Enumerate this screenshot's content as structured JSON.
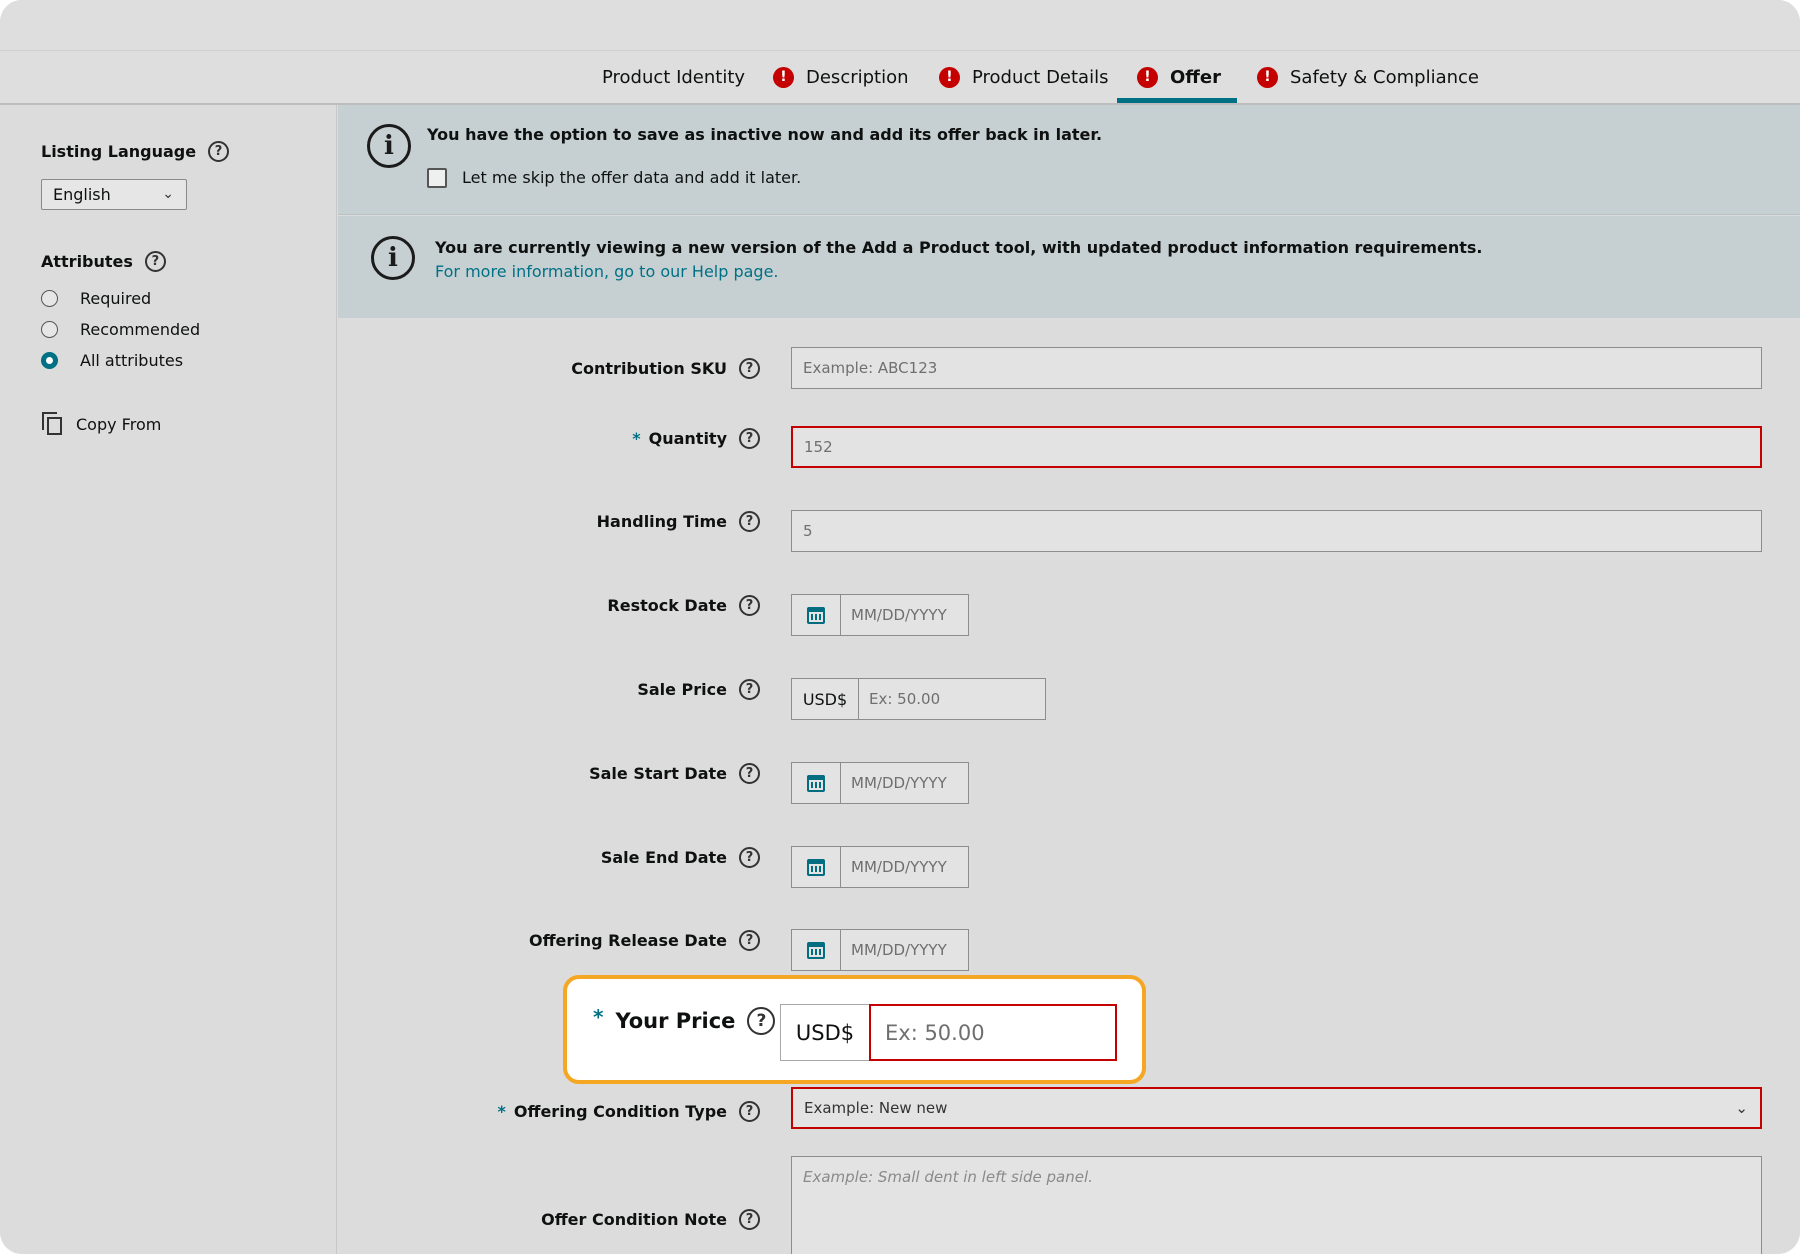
{
  "tabs": [
    {
      "label": "Product Identity",
      "error": false,
      "active": false
    },
    {
      "label": "Description",
      "error": true,
      "active": false
    },
    {
      "label": "Product Details",
      "error": true,
      "active": false
    },
    {
      "label": "Offer",
      "error": true,
      "active": true
    },
    {
      "label": "Safety & Compliance",
      "error": true,
      "active": false
    }
  ],
  "sidebar": {
    "listing_language_label": "Listing Language",
    "language_value": "English",
    "attributes_label": "Attributes",
    "attribute_options": [
      {
        "label": "Required",
        "checked": false
      },
      {
        "label": "Recommended",
        "checked": false
      },
      {
        "label": "All attributes",
        "checked": true
      }
    ],
    "copy_from_label": "Copy From"
  },
  "banners": {
    "skip_title": "You have the option to save as inactive now and add its offer back in later.",
    "skip_checkbox_label": "Let me skip the offer data and add it later.",
    "skip_checked": false,
    "version_title": "You are currently viewing a new version of the Add a Product tool, with updated product information requirements.",
    "version_link": "For more information, go to our Help page."
  },
  "form": {
    "contribution_sku": {
      "label": "Contribution SKU",
      "required": false,
      "placeholder": "Example: ABC123",
      "value": ""
    },
    "quantity": {
      "label": "Quantity",
      "required": true,
      "value": "152"
    },
    "handling_time": {
      "label": "Handling Time",
      "required": false,
      "value": "5"
    },
    "restock_date": {
      "label": "Restock Date",
      "placeholder": "MM/DD/YYYY"
    },
    "sale_price": {
      "label": "Sale Price",
      "currency": "USD$",
      "placeholder": "Ex: 50.00"
    },
    "sale_start_date": {
      "label": "Sale Start Date",
      "placeholder": "MM/DD/YYYY"
    },
    "sale_end_date": {
      "label": "Sale End Date",
      "placeholder": "MM/DD/YYYY"
    },
    "offering_release_date": {
      "label": "Offering Release Date",
      "placeholder": "MM/DD/YYYY"
    },
    "your_price": {
      "label": "Your Price",
      "required": true,
      "currency": "USD$",
      "placeholder": "Ex: 50.00"
    },
    "offering_condition_type": {
      "label": "Offering Condition Type",
      "required": true,
      "placeholder": "Example: New new"
    },
    "offer_condition_note": {
      "label": "Offer Condition Note",
      "placeholder": "Example: Small dent in left side panel."
    }
  },
  "help_glyph": "?",
  "required_glyph": "*",
  "error_glyph": "!",
  "info_glyph": "i",
  "chevron_glyph": "⌄",
  "colors": {
    "accent": "#007185",
    "error": "#c40000",
    "highlight": "#f5a623",
    "banner": "#c6d0d2"
  }
}
